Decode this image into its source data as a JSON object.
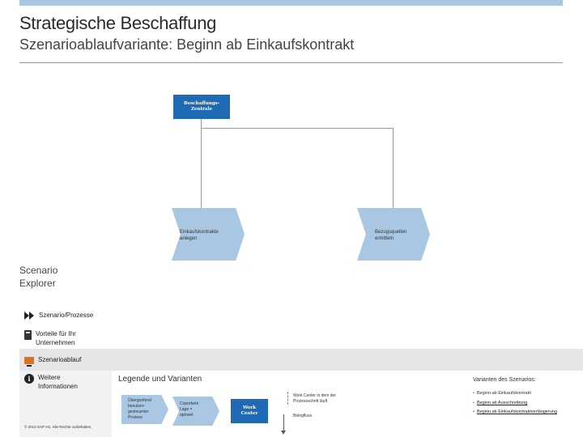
{
  "header": {
    "title": "Strategische Beschaffung",
    "subtitle": "Szenarioablaufvariante: Beginn ab Einkaufskontrakt"
  },
  "diagram": {
    "start_box": {
      "line1": "Beschaffungs-",
      "line2": "Zentrale"
    },
    "chevrons": [
      {
        "line1": "Einkaufskontrakte",
        "line2": "anlegen"
      },
      {
        "line1": "Bezugsquellen",
        "line2": "ermitteln"
      }
    ]
  },
  "explorer": {
    "line1": "Scenario",
    "line2": "Explorer"
  },
  "menu": [
    {
      "line1": "Szenario/Prozesse",
      "line2": "",
      "icon": "chevrons-icon"
    },
    {
      "line1": "Vorteile für Ihr",
      "line2": "Unternehmen",
      "icon": "calculator-icon"
    },
    {
      "line1": "Szenarioablauf",
      "line2": "",
      "icon": "monitor-icon"
    },
    {
      "line1": "Weitere",
      "line2": "Informationen",
      "icon": "info-icon"
    }
  ],
  "legend": {
    "title": "Legende und Varianten",
    "chev1": {
      "line1": "Übergreifend",
      "line2": "benutzer-",
      "line3": "gesteuerter",
      "line4": "Prozess"
    },
    "chev2": {
      "line1": "Coporbete",
      "line2": "Lage =",
      "line3": "aptoset"
    },
    "box": {
      "line1": "Work",
      "line2": "Center"
    },
    "note1": {
      "line1": "Work Center in dem der",
      "line2": "Prozessschritt läuft"
    },
    "note2": "Belegfluss"
  },
  "variants": {
    "title": "Varianten des Szenarios:",
    "items": [
      {
        "text": "Beginn ab Einkaufskontrakt",
        "link": false
      },
      {
        "text": "Beginn ab Ausschreibung",
        "link": true
      },
      {
        "text": "Beginn ab Einkaufskontraktverlängerung",
        "link": true
      }
    ]
  },
  "footer": {
    "copyright": "© 2013 SAP AG. Alle Rechte vorbehalten."
  },
  "colors": {
    "accent": "#1e6ab4",
    "chevron": "#a9c7e2",
    "highlight_icon": "#e07020"
  }
}
